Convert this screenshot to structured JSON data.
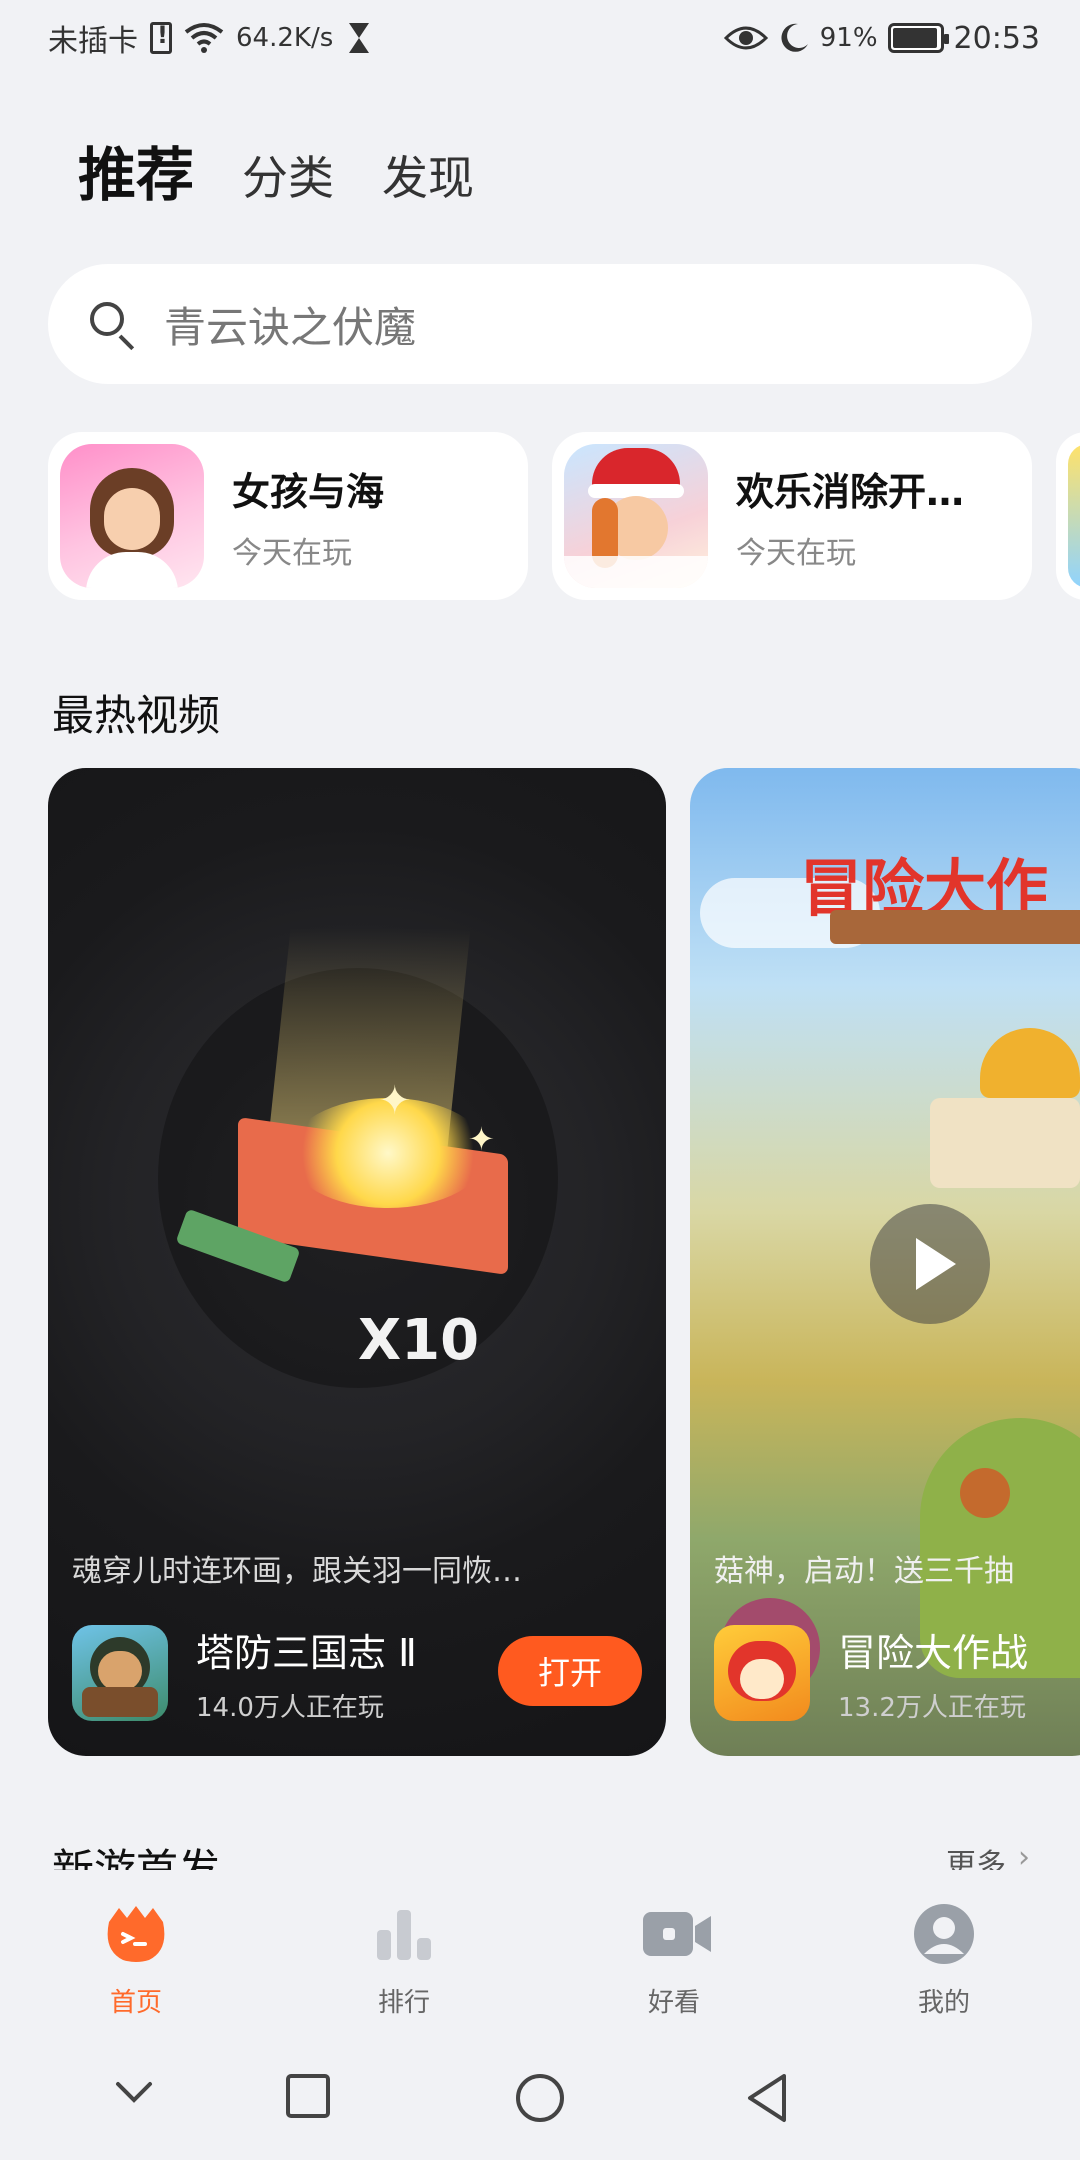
{
  "status_bar": {
    "carrier": "未插卡",
    "speed": "64.2K/s",
    "battery": "91%",
    "time": "20:53"
  },
  "top_tabs": [
    {
      "label": "推荐",
      "active": true
    },
    {
      "label": "分类",
      "active": false
    },
    {
      "label": "发现",
      "active": false
    }
  ],
  "search": {
    "placeholder": "青云诀之伏魔"
  },
  "recent_games": [
    {
      "title": "女孩与海",
      "subtitle": "今天在玩"
    },
    {
      "title": "欢乐消除开…",
      "subtitle": "今天在玩"
    }
  ],
  "hot_videos": {
    "section_title": "最热视频",
    "cards": [
      {
        "overlay_text": "X10",
        "description": "魂穿儿时连环画，跟关羽一同恢…",
        "game_name": "塔防三国志 Ⅱ",
        "players": "14.0万人正在玩",
        "button_label": "打开"
      },
      {
        "overlay_text": "冒险大作",
        "description": "菇神，启动！送三千抽",
        "game_name": "冒险大作战",
        "players": "13.2万人正在玩"
      }
    ]
  },
  "new_games": {
    "section_title": "新游首发",
    "more_label": "更多"
  },
  "bottom_nav": [
    {
      "label": "首页",
      "active": true
    },
    {
      "label": "排行",
      "active": false
    },
    {
      "label": "好看",
      "active": false
    },
    {
      "label": "我的",
      "active": false
    }
  ],
  "colors": {
    "accent": "#ff6a2b",
    "button": "#ff5a1f",
    "background": "#f1f2f5"
  }
}
